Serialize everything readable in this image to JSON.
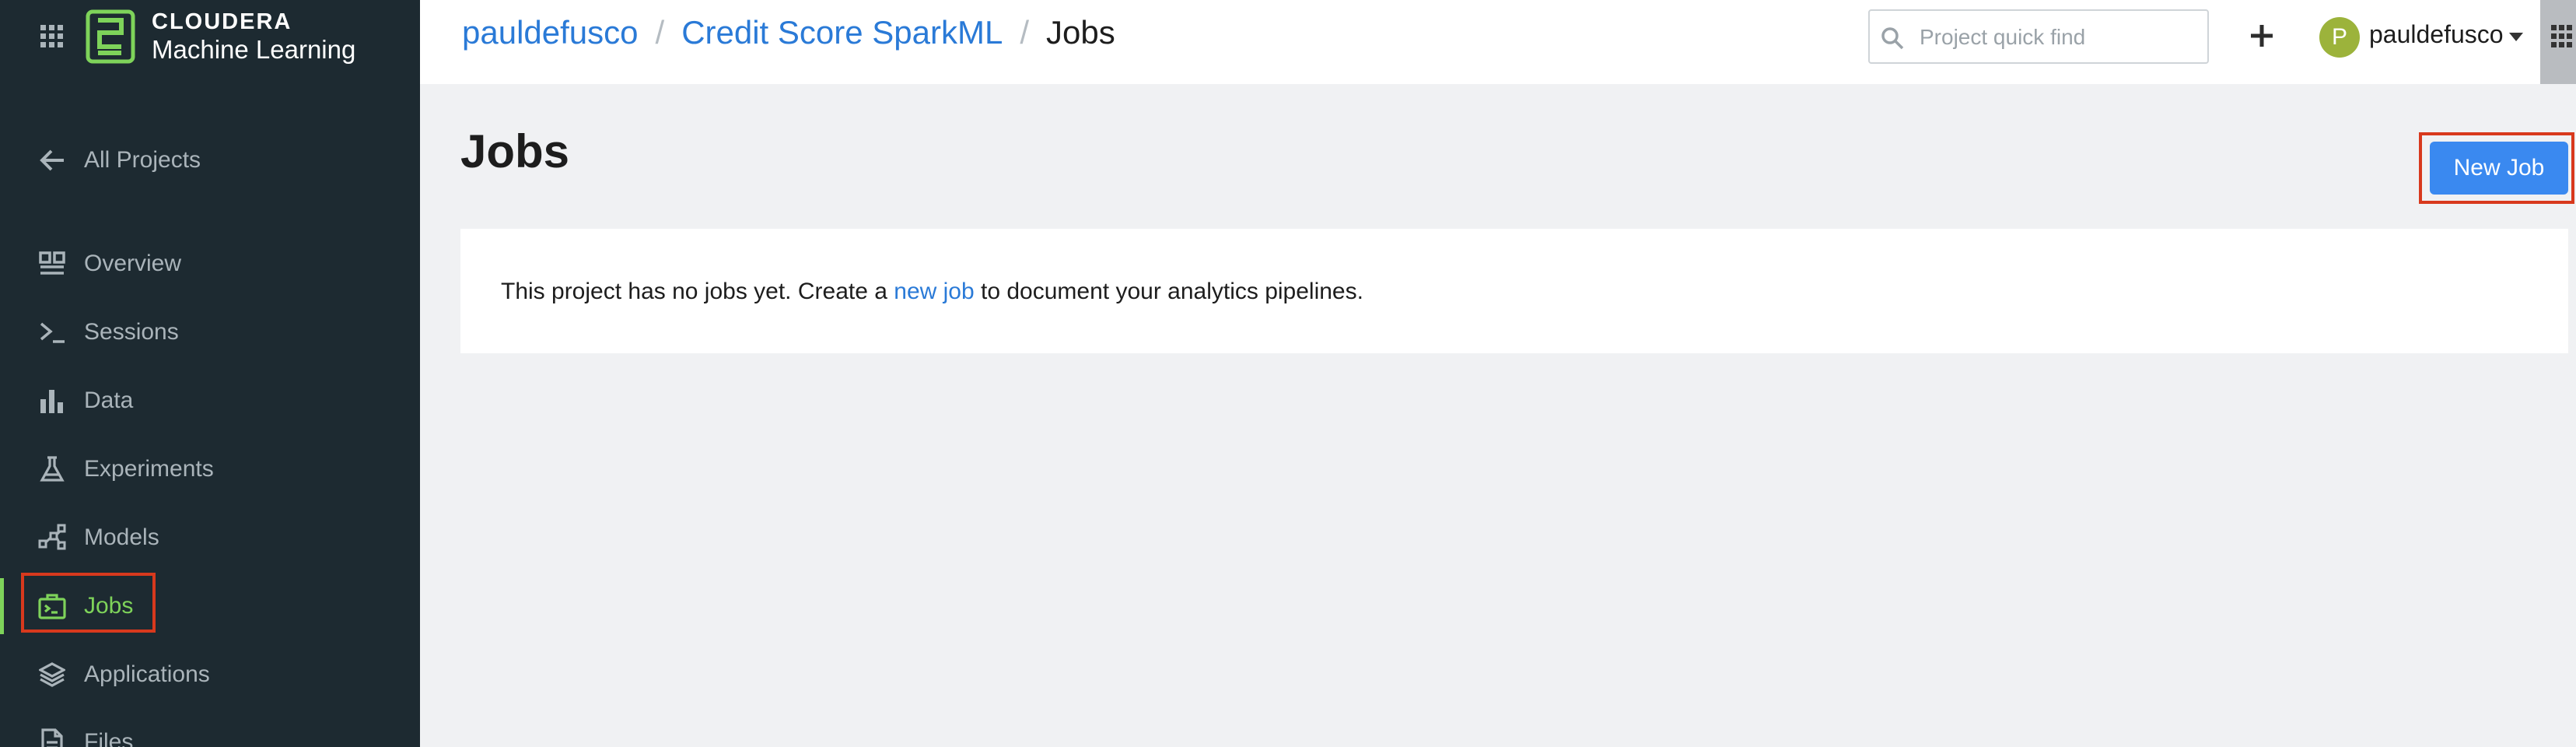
{
  "brand": {
    "name": "CLOUDERA",
    "product": "Machine Learning"
  },
  "sidebar": {
    "back_label": "All Projects",
    "items": [
      {
        "label": "Overview",
        "icon": "overview-icon"
      },
      {
        "label": "Sessions",
        "icon": "terminal-icon"
      },
      {
        "label": "Data",
        "icon": "bar-chart-icon"
      },
      {
        "label": "Experiments",
        "icon": "flask-icon"
      },
      {
        "label": "Models",
        "icon": "model-graph-icon"
      },
      {
        "label": "Jobs",
        "icon": "jobs-briefcase-icon",
        "active": true
      },
      {
        "label": "Applications",
        "icon": "layers-icon"
      },
      {
        "label": "Files",
        "icon": "file-icon"
      }
    ]
  },
  "header": {
    "breadcrumb": [
      "pauldefusco",
      "Credit Score SparkML",
      "Jobs"
    ],
    "separator": "/",
    "search_placeholder": "Project quick find",
    "user": {
      "initial": "P",
      "name": "pauldefusco"
    }
  },
  "main": {
    "title": "Jobs",
    "new_job_label": "New Job",
    "empty_message": {
      "before": "This project has no jobs yet. Create a ",
      "link": "new job",
      "after": " to document your analytics pipelines."
    }
  },
  "colors": {
    "sidebar_bg": "#1d2a31",
    "active_green": "#7ed35a",
    "link_blue": "#2a7ad7",
    "button_blue": "#3a89f0",
    "highlight_red": "#d8391d",
    "avatar_green": "#9cb33b"
  }
}
